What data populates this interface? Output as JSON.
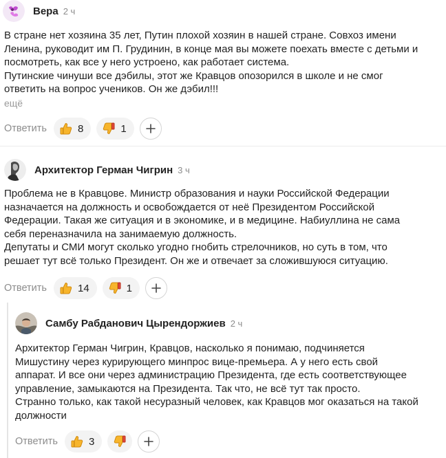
{
  "comments": [
    {
      "author": "Вера",
      "time": "2 ч",
      "lines": [
        "В стране нет хозяина 35 лет, Путин плохой хозяин в нашей стране. Совхоз имени",
        "Ленина, руководит им П. Грудинин, в конце мая вы можете поехать вместе с детьми и",
        "посмотреть, как все у него устроено, как работает система.",
        "Путинские чинуши все дэбилы, этот же Кравцов опозорился в школе и не смог",
        "ответить на вопрос учеников. Он же дэбил!!!"
      ],
      "more": "ещё",
      "reply": "Ответить",
      "likes": "8",
      "dislikes": "1"
    },
    {
      "author": "Архитектор Герман Чигрин",
      "time": "3 ч",
      "lines": [
        "Проблема не в Кравцове. Министр образования и науки Российской Федерации",
        "назначается на должность и освобождается от неё Президентом Российской",
        "Федерации. Такая же ситуация и в экономике, и в медицине. Набиуллина не сама",
        "себя переназначила на занимаемую должность.",
        "Депутаты и СМИ могут сколько угодно гнобить стрелочников, но суть в том, что",
        "решает тут всё только Президент. Он же и отвечает за сложившуюся ситуацию."
      ],
      "reply": "Ответить",
      "likes": "14",
      "dislikes": "1"
    },
    {
      "author": "Самбу Рабданович Цырендоржиев",
      "time": "2 ч",
      "lines": [
        "Архитектор Герман Чигрин, Кравцов, насколько я понимаю, подчиняется",
        "Мишустину через курирующего минпрос вице-премьера. А у него есть свой",
        "аппарат. И все они через администрацию Президента, где есть соответствующее",
        "управление, замыкаются на Президента. Так что, не всё тут так просто.",
        "Странно только, как такой несуразный человек, как Кравцов мог оказаться на такой",
        "должности"
      ],
      "reply": "Ответить",
      "likes": "3"
    }
  ],
  "icons": {
    "like": "thumbs-up-emoji-icon",
    "dislike": "thumbs-down-emoji-icon",
    "add": "plus-icon"
  },
  "colors": {
    "emoji_yellow": "#f7b52c",
    "muted_text": "#8c8c8c"
  }
}
